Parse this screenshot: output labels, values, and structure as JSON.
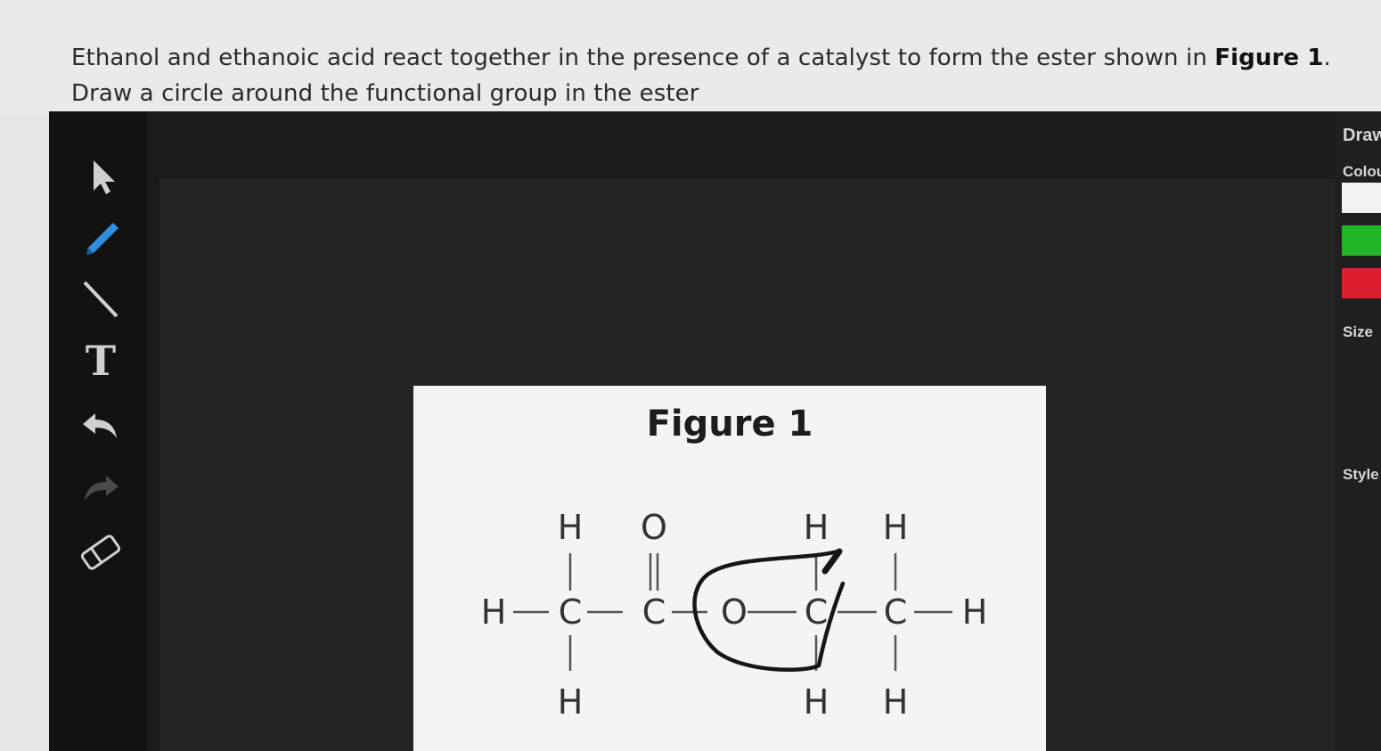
{
  "question": {
    "line1_text": "Ethanol and ethanoic acid react together in the presence of a catalyst to form the ester shown in ",
    "line1_bold": "Figure 1",
    "line1_end": ".",
    "line2": "Draw a circle around the functional group in the ester"
  },
  "toolbar": {
    "tools": [
      "select",
      "pen",
      "line",
      "text",
      "undo",
      "redo",
      "eraser"
    ],
    "text_tool_label": "T"
  },
  "panel": {
    "draw": "Draw",
    "colour": "Colour",
    "size": "Size",
    "style": "Style",
    "colors": [
      "#f2f2f2",
      "#21b526",
      "#dd1e2e"
    ]
  },
  "figure": {
    "title": "Figure 1",
    "atoms": {
      "h": "H",
      "c": "C",
      "o": "O"
    }
  },
  "colors": {
    "question_bg": "#eaeae8",
    "canvas_bg": "#242424",
    "panel_bg": "#1f1f1f",
    "figure_bg": "#f4f4f2",
    "pen_blue": "#2f8fe0"
  }
}
